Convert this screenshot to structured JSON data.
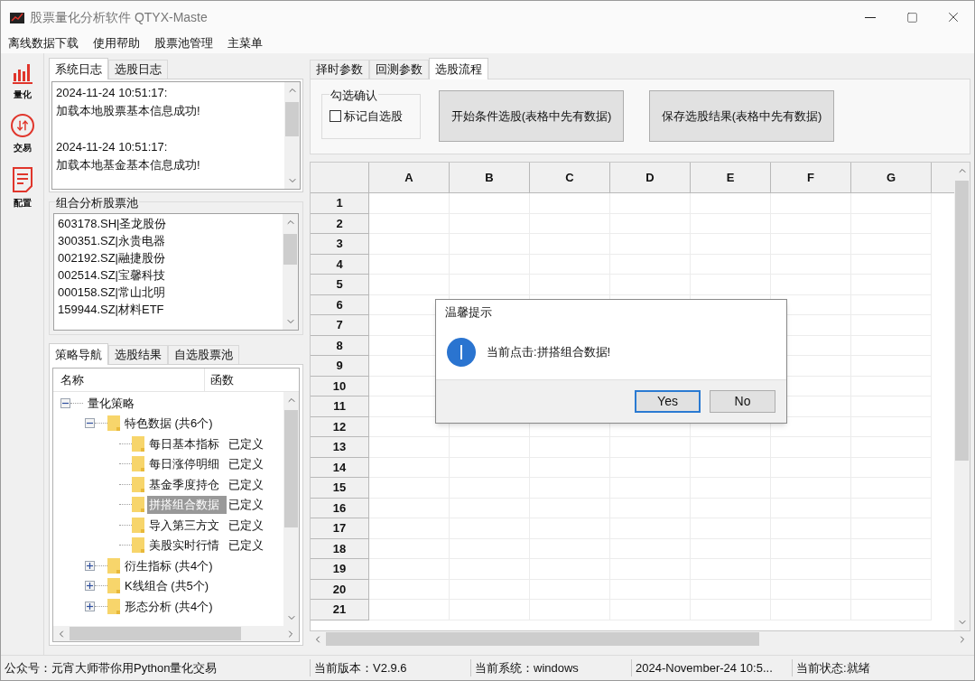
{
  "window": {
    "title": "股票量化分析软件 QTYX-Maste"
  },
  "menu": [
    "离线数据下载",
    "使用帮助",
    "股票池管理",
    "主菜单"
  ],
  "rail": [
    {
      "label": "量化",
      "kind": "chart"
    },
    {
      "label": "交易",
      "kind": "trade"
    },
    {
      "label": "配置",
      "kind": "doc"
    }
  ],
  "log_tabs": [
    {
      "label": "系统日志",
      "selected": true
    },
    {
      "label": "选股日志",
      "selected": false
    }
  ],
  "log_entries": [
    {
      "time": "2024-11-24 10:51:17:",
      "message": "加载本地股票基本信息成功!"
    },
    {
      "time": "2024-11-24 10:51:17:",
      "message": "加载本地基金基本信息成功!"
    }
  ],
  "pool": {
    "title": "组合分析股票池",
    "items": [
      "603178.SH|圣龙股份",
      "300351.SZ|永贵电器",
      "002192.SZ|融捷股份",
      "002514.SZ|宝馨科技",
      "000158.SZ|常山北明",
      "159944.SZ|材料ETF"
    ]
  },
  "nav_tabs": [
    {
      "label": "策略导航",
      "selected": true
    },
    {
      "label": "选股结果",
      "selected": false
    },
    {
      "label": "自选股票池",
      "selected": false
    }
  ],
  "tree": {
    "columns": [
      "名称",
      "函数"
    ],
    "nodes": [
      {
        "label": "量化策略",
        "expanded": true,
        "selected": false,
        "children": [
          {
            "label": "特色数据 (共6个)",
            "expanded": true,
            "selected": false,
            "children": [
              {
                "label": "每日基本指标",
                "func": "已定义",
                "selected": false
              },
              {
                "label": "每日涨停明细",
                "func": "已定义",
                "selected": false
              },
              {
                "label": "基金季度持仓",
                "func": "已定义",
                "selected": false
              },
              {
                "label": "拼搭组合数据",
                "func": "已定义",
                "selected": true
              },
              {
                "label": "导入第三方文",
                "func": "已定义",
                "selected": false
              },
              {
                "label": "美股实时行情",
                "func": "已定义",
                "selected": false
              }
            ]
          },
          {
            "label": "衍生指标 (共4个)",
            "expanded": false,
            "selected": false
          },
          {
            "label": "K线组合 (共5个)",
            "expanded": false,
            "selected": false
          },
          {
            "label": "形态分析 (共4个)",
            "expanded": false,
            "selected": false
          }
        ]
      }
    ]
  },
  "right_tabs": [
    {
      "label": "择时参数",
      "selected": false
    },
    {
      "label": "回测参数",
      "selected": false
    },
    {
      "label": "选股流程",
      "selected": true
    }
  ],
  "confirm_group": {
    "title": "勾选确认",
    "checkbox": {
      "label": "标记自选股",
      "checked": false
    }
  },
  "actions": [
    "开始条件选股(表格中先有数据)",
    "保存选股结果(表格中先有数据)"
  ],
  "sheet": {
    "columns": [
      "A",
      "B",
      "C",
      "D",
      "E",
      "F",
      "G"
    ],
    "rows": [
      "1",
      "2",
      "3",
      "4",
      "5",
      "6",
      "7",
      "8",
      "9",
      "10",
      "11",
      "12",
      "13",
      "14",
      "15",
      "16",
      "17",
      "18",
      "19",
      "20",
      "21"
    ]
  },
  "dialog": {
    "title": "温馨提示",
    "message": "当前点击:拼搭组合数据!",
    "buttons": [
      {
        "label": "Yes",
        "default": true
      },
      {
        "label": "No",
        "default": false
      }
    ]
  },
  "status_bar": {
    "left": "公众号：元宵大师带你用Python量化交易",
    "fields": [
      "当前版本：V2.9.6",
      "当前系统：windows",
      "2024-November-24 10:5...",
      "当前状态:就绪"
    ]
  }
}
